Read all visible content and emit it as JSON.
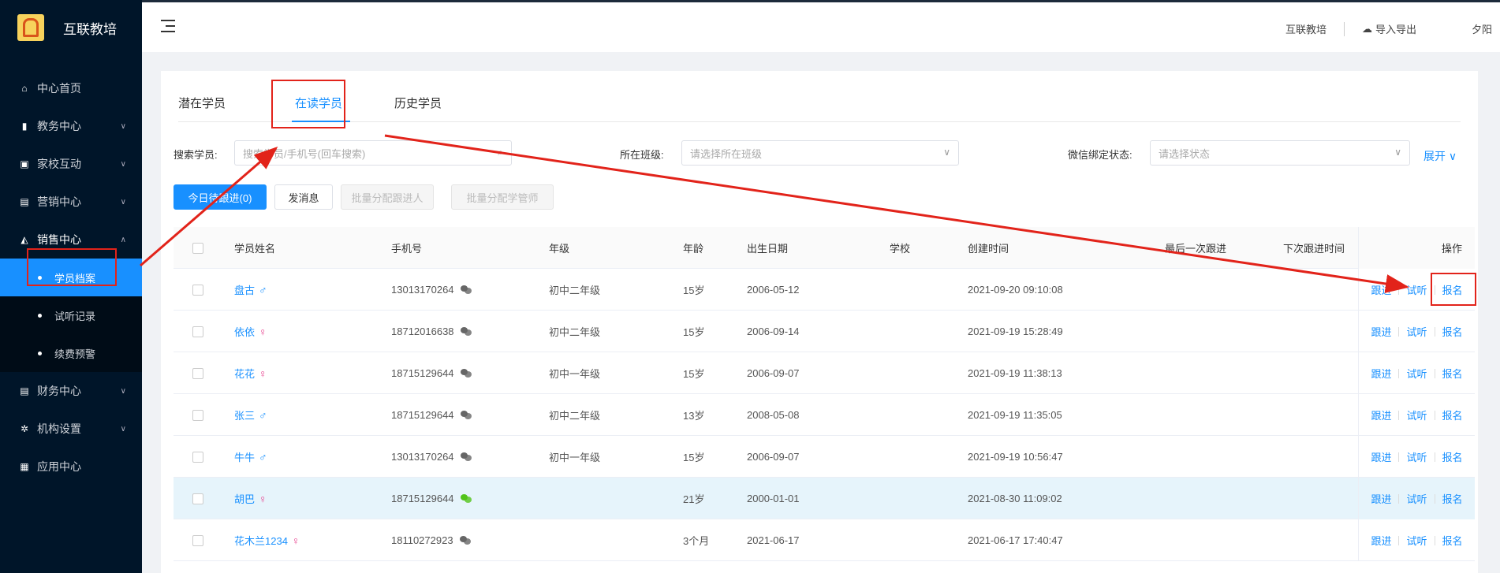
{
  "app": {
    "name": "互联教培"
  },
  "sidebar": {
    "items": [
      {
        "label": "中心首页",
        "icon": "home-icon"
      },
      {
        "label": "教务中心",
        "icon": "book-icon"
      },
      {
        "label": "家校互动",
        "icon": "chat-icon"
      },
      {
        "label": "营销中心",
        "icon": "bag-icon"
      },
      {
        "label": "销售中心",
        "icon": "sales-icon"
      },
      {
        "label": "财务中心",
        "icon": "wallet-icon"
      },
      {
        "label": "机构设置",
        "icon": "gear-icon"
      },
      {
        "label": "应用中心",
        "icon": "grid-icon"
      }
    ],
    "sales_sub": [
      "学员档案",
      "试听记录",
      "续费预警"
    ]
  },
  "header": {
    "org": "互联教培",
    "import_export": "导入导出",
    "user": "夕阳"
  },
  "tabs": [
    "潜在学员",
    "在读学员",
    "历史学员"
  ],
  "filters": {
    "search_label": "搜索学员:",
    "search_placeholder": "搜索学员/手机号(回车搜索)",
    "class_label": "所在班级:",
    "class_placeholder": "请选择所在班级",
    "wechat_label": "微信绑定状态:",
    "wechat_placeholder": "请选择状态",
    "expand": "展开"
  },
  "actions": {
    "today_follow": "今日待跟进(0)",
    "send_message": "发消息",
    "batch_follow": "批量分配跟进人",
    "batch_manager": "批量分配学管师"
  },
  "table": {
    "headers": [
      "学员姓名",
      "手机号",
      "年级",
      "年龄",
      "出生日期",
      "学校",
      "创建时间",
      "最后一次跟进",
      "下次跟进时间",
      "操作"
    ],
    "ops": [
      "跟进",
      "试听",
      "报名"
    ],
    "rows": [
      {
        "name": "盘古",
        "gender": "male",
        "phone": "13013170264",
        "wechat": false,
        "grade": "初中二年级",
        "age": "15岁",
        "birth": "2006-05-12",
        "created": "2021-09-20 09:10:08"
      },
      {
        "name": "依依",
        "gender": "female",
        "phone": "18712016638",
        "wechat": false,
        "grade": "初中二年级",
        "age": "15岁",
        "birth": "2006-09-14",
        "created": "2021-09-19 15:28:49"
      },
      {
        "name": "花花",
        "gender": "female",
        "phone": "18715129644",
        "wechat": false,
        "grade": "初中一年级",
        "age": "15岁",
        "birth": "2006-09-07",
        "created": "2021-09-19 11:38:13"
      },
      {
        "name": "张三",
        "gender": "male",
        "phone": "18715129644",
        "wechat": false,
        "grade": "初中二年级",
        "age": "13岁",
        "birth": "2008-05-08",
        "created": "2021-09-19 11:35:05"
      },
      {
        "name": "牛牛",
        "gender": "male",
        "phone": "13013170264",
        "wechat": false,
        "grade": "初中一年级",
        "age": "15岁",
        "birth": "2006-09-07",
        "created": "2021-09-19 10:56:47"
      },
      {
        "name": "胡巴",
        "gender": "female",
        "phone": "18715129644",
        "wechat": true,
        "grade": "",
        "age": "21岁",
        "birth": "2000-01-01",
        "created": "2021-08-30 11:09:02"
      },
      {
        "name": "花木兰1234",
        "gender": "female",
        "phone": "18110272923",
        "wechat": false,
        "grade": "",
        "age": "3个月",
        "birth": "2021-06-17",
        "created": "2021-06-17 17:40:47"
      }
    ]
  },
  "colors": {
    "sidebar": "#001529",
    "accent": "#1890ff",
    "annotation": "#e2231a",
    "wechat_bound": "#52c41a",
    "wechat_unbound": "#666666"
  }
}
